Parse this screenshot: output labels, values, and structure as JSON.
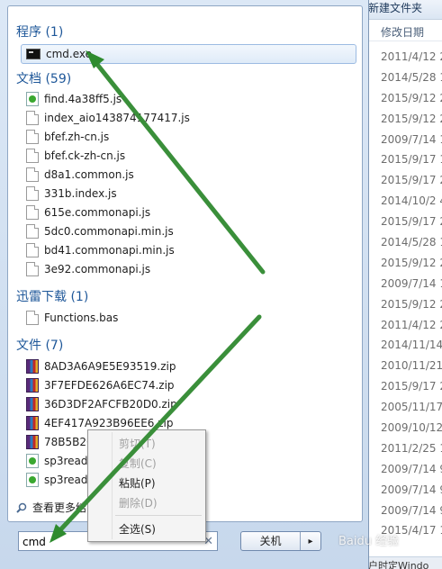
{
  "explorer": {
    "title": "新建文件夹",
    "column_header": "修改日期",
    "dates": [
      "2011/4/12 2",
      "2014/5/28 1",
      "2015/9/12 2",
      "2015/9/12 2",
      "2009/7/14 1",
      "2015/9/17 1",
      "2015/9/17 2",
      "2014/10/2 4",
      "2015/9/17 2",
      "2014/5/28 1",
      "2015/9/12 2",
      "2009/7/14 1",
      "2015/9/12 2",
      "2011/4/12 2",
      "2014/11/14",
      "2010/11/21",
      "2015/9/17 2",
      "2005/11/17",
      "2009/10/12",
      "2011/2/25 1",
      "2009/7/14 9",
      "2009/7/14 9",
      "2009/7/14 9",
      "2015/4/17 1"
    ],
    "status_fragment": "户时定Windo"
  },
  "groups": {
    "programs": {
      "header": "程序 (1)",
      "items": [
        {
          "name": "cmd.exe",
          "icon": "cmd-icon"
        }
      ]
    },
    "documents": {
      "header": "文档 (59)",
      "items": [
        {
          "name": "find.4a38ff5",
          "tail": ".js"
        },
        {
          "name": "index_aio1438",
          "tail": "74177417.js"
        },
        {
          "name": "bfef.zh-cn.js"
        },
        {
          "name": "bfef.ck-zh-cn.js"
        },
        {
          "name": "d8a1.common.js"
        },
        {
          "name": "331b.index.js"
        },
        {
          "name": "615e.commonapi.js"
        },
        {
          "name": "5dc0.commonapi.min.js"
        },
        {
          "name": "bd41.commonapi.min.js"
        },
        {
          "name": "3e92.commonapi.js"
        }
      ]
    },
    "thunder": {
      "header": "迅雷下载 (1)",
      "items": [
        {
          "name": "Functions.bas"
        }
      ]
    },
    "files": {
      "header": "文件 (7)",
      "items": [
        {
          "name": "8AD3A6A9E5E93519.zip"
        },
        {
          "name": "3F7EFDE626A6EC74.zip"
        },
        {
          "name": "36D3DF2AFCFB20D0.zip"
        },
        {
          "name": "4EF417A923B96EE6.zip"
        },
        {
          "name": "78B5B26"
        },
        {
          "name": "sp3read"
        },
        {
          "name": "sp3read"
        }
      ]
    }
  },
  "see_more": "查看更多结",
  "search": {
    "value": "cmd",
    "clear_glyph": "✕"
  },
  "shutdown": {
    "label": "关机",
    "arrow_glyph": "▸"
  },
  "context_menu": {
    "items": [
      {
        "label": "剪切(T)",
        "enabled": false
      },
      {
        "label": "复制(C)",
        "enabled": false
      },
      {
        "label": "粘贴(P)",
        "enabled": true
      },
      {
        "label": "删除(D)",
        "enabled": false
      },
      {
        "label": "全选(S)",
        "enabled": true
      }
    ]
  },
  "colors": {
    "arrow": "#2e8b2e",
    "group_header": "#1e5799",
    "highlight_border": "#9cbbe2"
  },
  "watermark": "Baidu 经验"
}
